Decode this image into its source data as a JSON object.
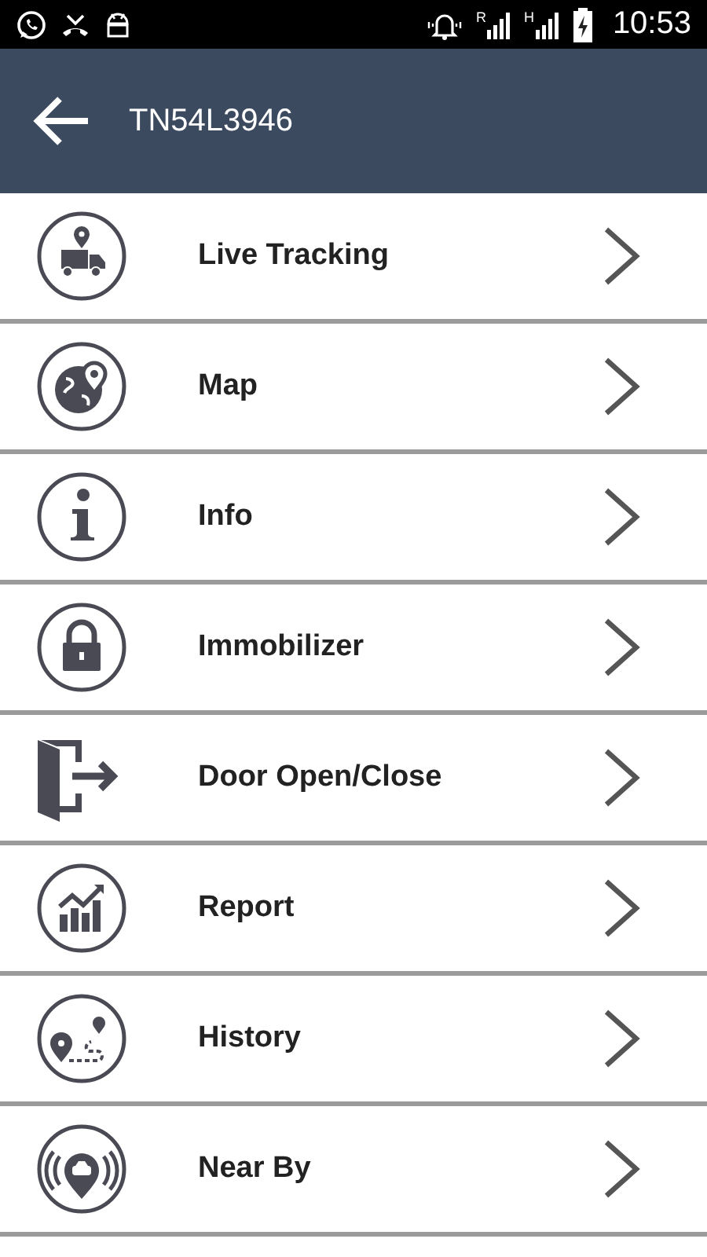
{
  "status_bar": {
    "signals": [
      "R",
      "H"
    ],
    "time": "10:53"
  },
  "app_bar": {
    "title": "TN54L3946"
  },
  "menu": [
    {
      "label": "Live Tracking"
    },
    {
      "label": "Map"
    },
    {
      "label": "Info"
    },
    {
      "label": "Immobilizer"
    },
    {
      "label": "Door Open/Close"
    },
    {
      "label": "Report"
    },
    {
      "label": "History"
    },
    {
      "label": "Near By"
    }
  ]
}
